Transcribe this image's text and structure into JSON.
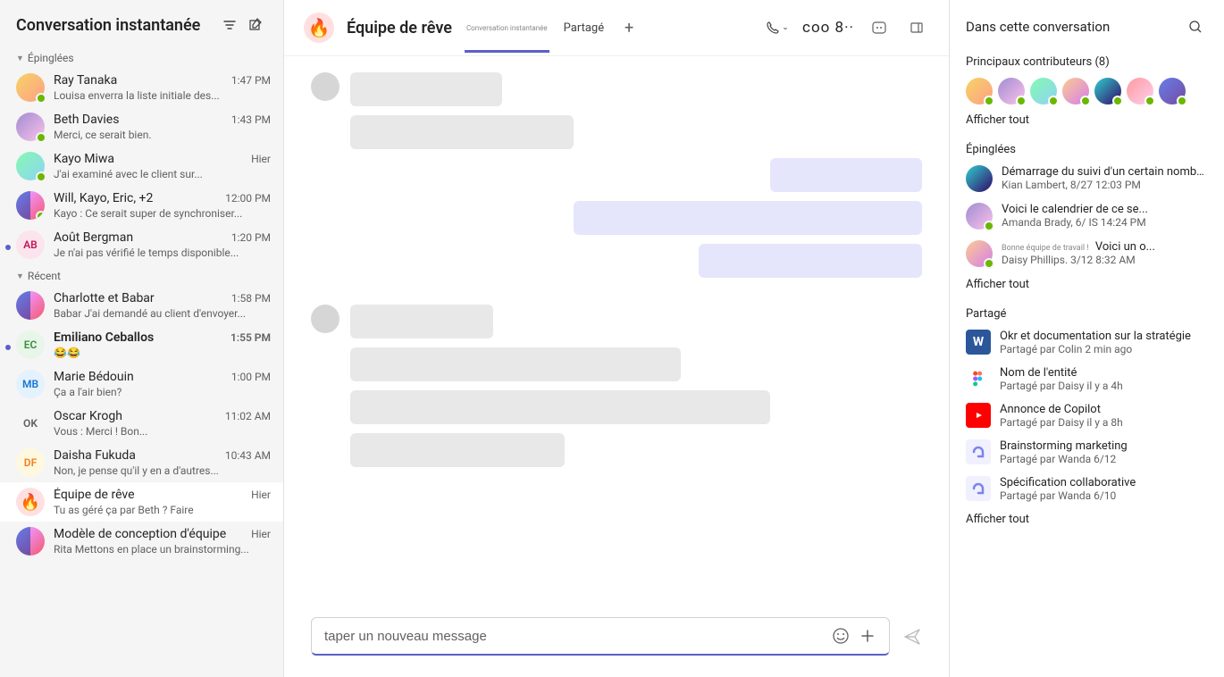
{
  "sidebar": {
    "title": "Conversation instantanée",
    "sections": {
      "pinned_label": "Épinglées",
      "recent_label": "Récent"
    },
    "pinned": [
      {
        "name": "Ray Tanaka",
        "time": "1:47 PM",
        "preview": "Louisa enverra la liste initiale des..."
      },
      {
        "name": "Beth Davies",
        "time": "1:43 PM",
        "preview": "Merci, ce serait bien."
      },
      {
        "name": "Kayo Miwa",
        "time": "Hier",
        "preview": "J'ai examiné avec le client sur..."
      },
      {
        "name": "Will, Kayo, Eric, +2",
        "time": "12:00 PM",
        "preview": "Kayo : Ce serait super de synchroniser..."
      },
      {
        "name": "Août Bergman",
        "time": "1:20 PM",
        "preview": "Je n'ai pas vérifié le temps disponible...",
        "initials": "AB"
      }
    ],
    "recent": [
      {
        "name": "Charlotte et     Babar",
        "time": "1:58 PM",
        "preview": "Babar J'ai demandé au client d'envoyer..."
      },
      {
        "name": "Emiliano Ceballos",
        "time": "1:55 PM",
        "preview": "😂😂",
        "initials": "EC"
      },
      {
        "name": "Marie Bédouin",
        "time": "1:00 PM",
        "preview": "Ça a l'air bien?",
        "initials": "MB"
      },
      {
        "name": "Oscar Krogh",
        "time": "11:02 AM",
        "preview": "Vous : Merci ! Bon...",
        "initials": "OK"
      },
      {
        "name": "Daisha Fukuda",
        "time": "10:43 AM",
        "preview": "Non, je pense qu'il y en a d'autres...",
        "initials": "DF"
      },
      {
        "name": "Équipe de rêve",
        "time": "Hier",
        "preview": "Tu as géré ça par Beth ? Faire"
      },
      {
        "name": "Modèle de conception d'équipe",
        "time": "Hier",
        "preview": "Rita Mettons en place un brainstorming..."
      }
    ]
  },
  "header": {
    "title": "Équipe de rêve",
    "tab_hidden": "Conversation instantanée",
    "tab_shared": "Partagé",
    "add": "+",
    "participants": "coo 8··"
  },
  "compose": {
    "placeholder": "taper un nouveau message"
  },
  "rightPanel": {
    "title": "Dans cette conversation",
    "contributors_title": "Principaux contributeurs (8)",
    "show_all": "Afficher tout",
    "pinned_label": "Épinglées",
    "pinned": [
      {
        "title": "Démarrage du suivi d'un certain nombre ...",
        "meta": "Kian Lambert, 8/27 12:03 PM"
      },
      {
        "title": "Voici le calendrier de ce se...",
        "meta": "Amanda Brady, 6/ IS 14:24 PM"
      },
      {
        "badge": "Bonne équipe de travail !",
        "title": "Voici un o...",
        "meta": "Daisy Phillips. 3/12 8:32 AM"
      }
    ],
    "shared_label": "Partagé",
    "shared": [
      {
        "icon": "word",
        "title": "Okr et documentation sur la stratégie",
        "meta": "Partagé par Colin 2 min ago"
      },
      {
        "icon": "figma",
        "title": "Nom de l'entité",
        "meta": "Partagé par Daisy il y a 4h"
      },
      {
        "icon": "youtube",
        "title": "Annonce de Copilot",
        "meta": "Partagé par Daisy il y a 8h"
      },
      {
        "icon": "loop",
        "title": "Brainstorming marketing",
        "meta": "Partagé par Wanda 6/12"
      },
      {
        "icon": "loop",
        "title": "Spécification collaborative",
        "meta": "Partagé par Wanda 6/10"
      }
    ]
  }
}
